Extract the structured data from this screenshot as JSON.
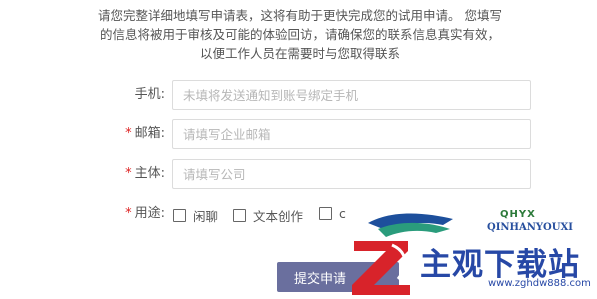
{
  "intro": {
    "text": "请您完整详细地填写申请表，这将有助于更快完成您的试用申请。 您填写的信息将被用于审核及可能的体验回访，请确保您的联系信息真实有效， 以便工作人员在需要时与您取得联系"
  },
  "form": {
    "phone": {
      "label": "手机:",
      "placeholder": "未填将发送通知到账号绑定手机",
      "required": false
    },
    "email": {
      "label": "邮箱:",
      "placeholder": "请填写企业邮箱",
      "required": true
    },
    "entity": {
      "label": "主体:",
      "placeholder": "请填写公司",
      "required": true
    },
    "usage": {
      "label": "用途:",
      "required": true,
      "options": [
        {
          "label": "闲聊",
          "checked": false
        },
        {
          "label": "文本创作",
          "checked": false
        },
        {
          "label": "c",
          "checked": false
        }
      ]
    },
    "required_mark": "*",
    "submit_label": "提交申请"
  },
  "watermark": {
    "top_letters": "QHYX",
    "sub": "QINHANYOUXI",
    "title": "主观下载站",
    "url": "www.zghdw888.com",
    "colors": {
      "blue": "#2748a6",
      "red": "#d8232a",
      "green": "#2c7a3a"
    }
  }
}
